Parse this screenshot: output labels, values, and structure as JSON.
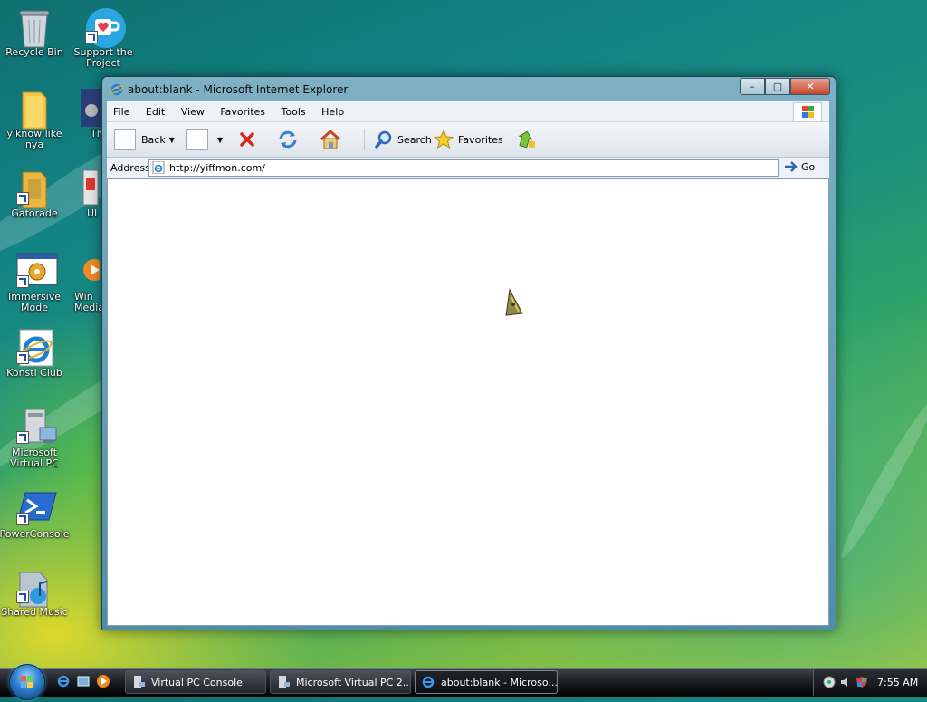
{
  "desktop": {
    "icons": [
      {
        "label": "Recycle Bin",
        "icon": "recycle-bin-icon"
      },
      {
        "label": "Support the Project",
        "icon": "heart-mug-icon"
      },
      {
        "label": "y'know like nya",
        "icon": "folder-icon"
      },
      {
        "label": "Th",
        "icon": "image-file-icon"
      },
      {
        "label": "Gatorade",
        "icon": "folder-icon"
      },
      {
        "label": "UI",
        "icon": "app-icon"
      },
      {
        "label": "Immersive Mode",
        "icon": "gear-window-icon"
      },
      {
        "label": "Win Media",
        "icon": "media-player-icon"
      },
      {
        "label": "Konsti Club",
        "icon": "internet-explorer-icon"
      },
      {
        "label": "Microsoft Virtual PC",
        "icon": "virtual-pc-icon"
      },
      {
        "label": "PowerConsole",
        "icon": "powershell-icon"
      },
      {
        "label": "Shared Music",
        "icon": "music-folder-icon"
      }
    ]
  },
  "window": {
    "title": "about:blank - Microsoft Internet Explorer",
    "controls": {
      "minimize": "–",
      "maximize": "▢",
      "close": "✕"
    },
    "menu": [
      "File",
      "Edit",
      "View",
      "Favorites",
      "Tools",
      "Help"
    ],
    "toolbar": {
      "back_label": "Back",
      "search_label": "Search",
      "favorites_label": "Favorites"
    },
    "address": {
      "label": "Address",
      "value": "http://yiffmon.com/",
      "go_label": "Go"
    }
  },
  "taskbar": {
    "tasks": [
      {
        "label": "Virtual PC Console",
        "active": false
      },
      {
        "label": "Microsoft Virtual PC 2...",
        "active": false
      },
      {
        "label": "about:blank - Microso...",
        "active": true
      }
    ],
    "clock": "7:55 AM"
  },
  "colors": {
    "accent": "#2d7fcc",
    "close_button": "#c8452d"
  }
}
